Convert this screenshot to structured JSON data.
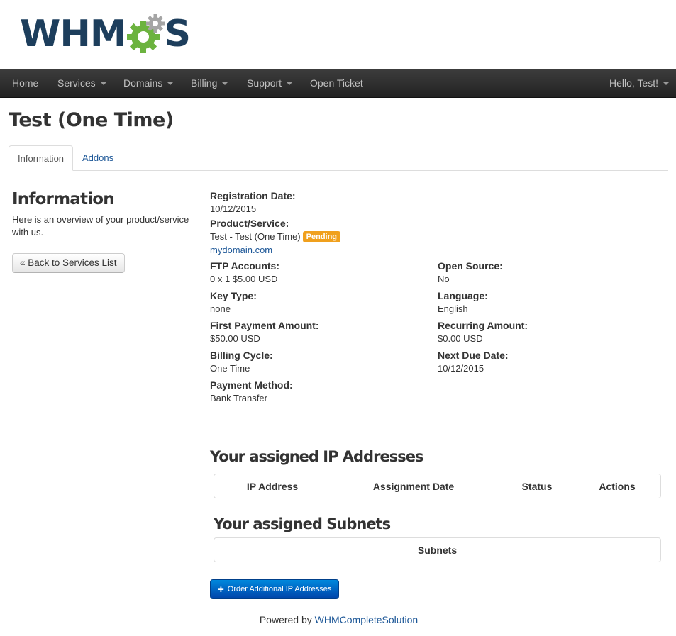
{
  "logo": {
    "text_left": "WHM",
    "text_right": "S",
    "icon": "gears-icon",
    "colors": {
      "text": "#1d3e5c",
      "gear_green": "#6cb33f",
      "gear_gray": "#a5a5a5"
    }
  },
  "navbar": {
    "items": [
      {
        "label": "Home",
        "has_dropdown": false
      },
      {
        "label": "Services",
        "has_dropdown": true
      },
      {
        "label": "Domains",
        "has_dropdown": true
      },
      {
        "label": "Billing",
        "has_dropdown": true
      },
      {
        "label": "Support",
        "has_dropdown": true
      },
      {
        "label": "Open Ticket",
        "has_dropdown": false
      }
    ],
    "user_menu": "Hello, Test!"
  },
  "page": {
    "title": "Test (One Time)"
  },
  "tabs": [
    {
      "label": "Information",
      "active": true
    },
    {
      "label": "Addons",
      "active": false
    }
  ],
  "sidebar": {
    "title": "Information",
    "description": "Here is an overview of your product/service with us.",
    "back_button": "« Back to Services List"
  },
  "details": {
    "registration_date": {
      "label": "Registration Date:",
      "value": "10/12/2015"
    },
    "product_service": {
      "label": "Product/Service:",
      "value": "Test - Test (One Time)",
      "status": "Pending",
      "status_color": "#f0a01d",
      "domain": "mydomain.com"
    },
    "ftp_accounts": {
      "label": "FTP Accounts:",
      "value": "0 x 1 $5.00 USD"
    },
    "open_source": {
      "label": "Open Source:",
      "value": "No"
    },
    "key_type": {
      "label": "Key Type:",
      "value": "none"
    },
    "language": {
      "label": "Language:",
      "value": "English"
    },
    "first_payment": {
      "label": "First Payment Amount:",
      "value": "$50.00 USD"
    },
    "recurring_amount": {
      "label": "Recurring Amount:",
      "value": "$0.00 USD"
    },
    "billing_cycle": {
      "label": "Billing Cycle:",
      "value": "One Time"
    },
    "next_due_date": {
      "label": "Next Due Date:",
      "value": "10/12/2015"
    },
    "payment_method": {
      "label": "Payment Method:",
      "value": "Bank Transfer"
    }
  },
  "ip_section": {
    "title": "Your assigned IP Addresses",
    "columns": [
      "IP Address",
      "Assignment Date",
      "Status",
      "Actions"
    ]
  },
  "subnet_section": {
    "title": "Your assigned Subnets",
    "columns": [
      "Subnets"
    ]
  },
  "order_button": {
    "label": "Order Additional IP Addresses",
    "icon": "plus-icon"
  },
  "footer": {
    "prefix": "Powered by",
    "link": "WHMCompleteSolution"
  }
}
